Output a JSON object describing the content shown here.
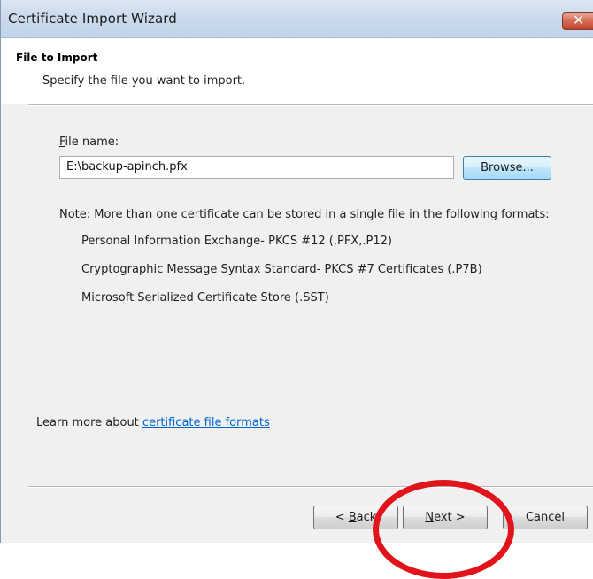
{
  "window": {
    "title": "Certificate Import Wizard",
    "close_glyph": "✕"
  },
  "header": {
    "title": "File to Import",
    "description": "Specify the file you want to import."
  },
  "file": {
    "label_accel": "F",
    "label_rest": "ile name:",
    "value": "E:\\backup-apinch.pfx",
    "browse_label": "Browse..."
  },
  "note": {
    "text": "Note:  More than one certificate can be stored in a single file in the following formats:",
    "formats": [
      "Personal Information Exchange- PKCS #12 (.PFX,.P12)",
      "Cryptographic Message Syntax Standard- PKCS #7 Certificates (.P7B)",
      "Microsoft Serialized Certificate Store (.SST)"
    ]
  },
  "learn_more": {
    "prefix": "Learn more about ",
    "link_text": "certificate file formats"
  },
  "buttons": {
    "back_prefix": "< ",
    "back_accel": "B",
    "back_rest": "ack",
    "next_accel": "N",
    "next_rest": "ext >",
    "cancel": "Cancel"
  },
  "colors": {
    "annotation_circle": "#e2141b",
    "link": "#0066cc"
  }
}
